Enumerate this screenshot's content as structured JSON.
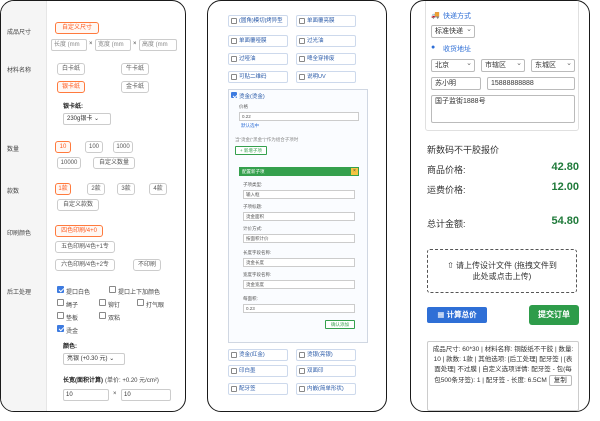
{
  "panel1": {
    "labels": {
      "size": "成品尺寸",
      "material": "材料名称",
      "quantity": "数量",
      "styles": "款数",
      "print_color": "印刷颜色",
      "post_process": "后工处理"
    },
    "size": {
      "custom_btn": "自定义尺寸",
      "length_ph": "长度 (mm",
      "width_ph": "宽度 (mm",
      "height_ph": "高度 (mm",
      "x": "×"
    },
    "material": {
      "options": [
        "白卡纸",
        "牛卡纸",
        "银卡纸",
        "金卡纸"
      ],
      "sub_label": "银卡纸:",
      "sub_value": "230g银卡",
      "sub_arrow": "⌄"
    },
    "quantity": {
      "options": [
        "10",
        "100",
        "1000",
        "10000"
      ],
      "custom": "自定义数量"
    },
    "styles": {
      "options": [
        "1款",
        "2款",
        "3款",
        "4款"
      ],
      "custom": "自定义款数"
    },
    "print_color": {
      "options": [
        "四色印刷/4+0",
        "五色印刷/4色+1专",
        "六色印刷/4色+2专",
        "不印刷"
      ]
    },
    "post_process": {
      "items": [
        "提口白色",
        "提口上下加颜色",
        "绳子",
        "铆钉",
        "打气眼",
        "垫板",
        "双粘",
        "烫金"
      ],
      "color_label": "颜色:",
      "color_value": "亮银 (+0.30 元)",
      "color_arrow": "⌄",
      "area_label": "长宽(面积计算)",
      "area_hint": "(单价: +0.20 元/cm²)",
      "length_value": "10",
      "width_value": "10",
      "x": "×"
    }
  },
  "panel2": {
    "top_rows": [
      [
        "(圆角)模切",
        "|烤异型",
        "单面覆亮膜"
      ],
      [
        "单面覆哑膜",
        "过光油"
      ],
      [
        "过哑油",
        "啤全穿排废"
      ],
      [
        "可贴二维码",
        "说明UV"
      ]
    ],
    "top_rows_text": [
      [
        "(圆角)模切|烤异型",
        "单面覆亮膜"
      ],
      [
        "单面覆哑膜",
        "过光油"
      ],
      [
        "过哑油",
        "啤全穿排废"
      ],
      [
        "可贴二维码",
        "说明UV"
      ]
    ],
    "section_title": "烫金(烫金)",
    "unit_label": "价格",
    "unit_value": "0.22",
    "unit_note": "默认选中",
    "hint": "当“烫金(\"黑金\")”作为组合子项时",
    "add_child": "+ 新增子项",
    "group_title": "配置新子项",
    "close": "×",
    "type_label": "子项类型:",
    "type_value": "输入框",
    "name_label": "子项标题:",
    "name_value": "烫金面积",
    "calc_label": "计价方式:",
    "calc_value": "按面积计价",
    "lfield_label": "长度字段名称:",
    "lfield_value": "烫金长度",
    "wfield_label": "宽度字段名称:",
    "wfield_value": "烫金宽度",
    "price_label": "每面积:",
    "price_value": "0.23",
    "confirm": "确认添加",
    "bottom_rows": [
      [
        "烫金(红金)",
        "烫银(亮银)"
      ],
      [
        "印白墨",
        "双面印"
      ],
      [
        "配牙签",
        "内嵌(简单形状)"
      ]
    ]
  },
  "panel3": {
    "express_label": "快递方式",
    "express_value": "标准快递",
    "address_label": "收货地址",
    "province": "北京",
    "city": "市辖区",
    "district": "东城区",
    "name": "苏小明",
    "phone": "15888888888",
    "address": "国子监街1888号",
    "quote_title": "新数码不干胶报价",
    "goods_label": "商品价格:",
    "goods_value": "42.80",
    "ship_label": "运费价格:",
    "ship_value": "12.00",
    "total_label": "总计金额:",
    "total_value": "54.80",
    "upload_line1": "⇧ 请上传设计文件 (拖拽文件到",
    "upload_line2": "此处或点击上传)",
    "calc_btn": "计算总价",
    "submit_btn": "提交订单",
    "summary": "成品尺寸: 60*30 | 材料名称: 铜版纸不干胶 | 数量: 10 | 款数: 1款 | 其他选项: [后工处理] 配牙签 | [表面处理] 不过膜 | 自定义选项详情: 配牙签 - 包(每包500条牙签): 1 | 配牙签 - 长度: 6.5CM",
    "copy": "复制"
  },
  "colors": {
    "accent_orange": "#ff5a1f",
    "accent_blue": "#2f6fd6",
    "accent_green": "#2e9c4a"
  }
}
